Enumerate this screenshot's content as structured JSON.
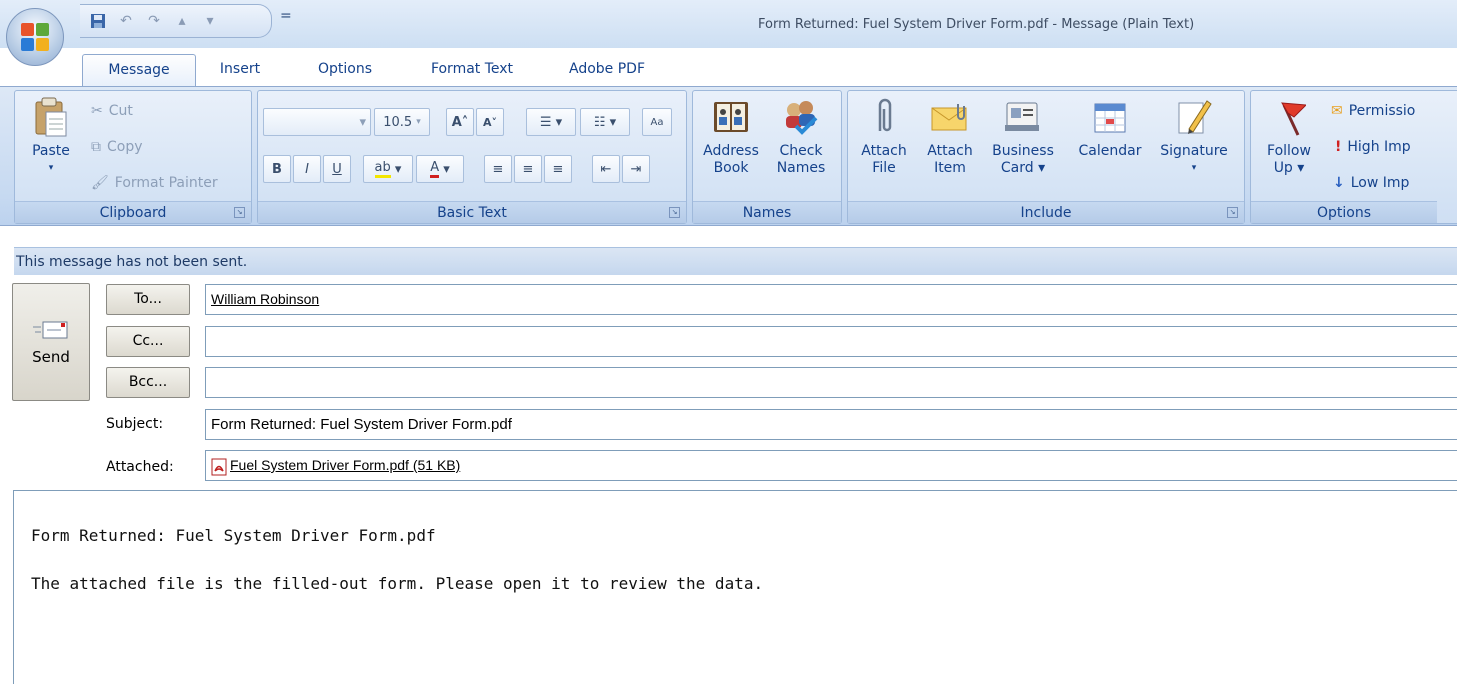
{
  "window": {
    "title": "Form Returned: Fuel System Driver Form.pdf  -  Message (Plain Text)"
  },
  "qat": {
    "icons": [
      "save-icon",
      "undo-icon",
      "redo-icon",
      "up-arrow-icon",
      "down-arrow-icon"
    ],
    "more": "="
  },
  "tabs": [
    "Message",
    "Insert",
    "Options",
    "Format Text",
    "Adobe PDF"
  ],
  "ribbon": {
    "clipboard": {
      "label": "Clipboard",
      "paste": "Paste",
      "cut": "Cut",
      "copy": "Copy",
      "format_painter": "Format Painter"
    },
    "basic_text": {
      "label": "Basic Text",
      "font_size": "10.5"
    },
    "names": {
      "label": "Names",
      "address_book": [
        "Address",
        "Book"
      ],
      "check_names": [
        "Check",
        "Names"
      ]
    },
    "include": {
      "label": "Include",
      "attach_file": [
        "Attach",
        "File"
      ],
      "attach_item": [
        "Attach",
        "Item"
      ],
      "business_card": [
        "Business",
        "Card ▾"
      ],
      "calendar": "Calendar",
      "signature": "Signature"
    },
    "options": {
      "label": "Options",
      "follow_up": [
        "Follow",
        "Up ▾"
      ],
      "permission": "Permissio",
      "high_importance": "High Imp",
      "low_importance": "Low Imp"
    }
  },
  "message": {
    "notice": "This message has not been sent.",
    "send": "Send",
    "to_button": "To...",
    "cc_button": "Cc...",
    "bcc_button": "Bcc...",
    "to_value": "William Robinson",
    "cc_value": "",
    "bcc_value": "",
    "subject_label": "Subject:",
    "subject_value": "Form Returned: Fuel System Driver Form.pdf",
    "attached_label": "Attached:",
    "attachment": "Fuel System Driver Form.pdf (51 KB)",
    "body_lines": [
      "Form Returned: Fuel System Driver Form.pdf",
      "",
      "The attached file is the filled-out form. Please open it to review the data."
    ]
  }
}
